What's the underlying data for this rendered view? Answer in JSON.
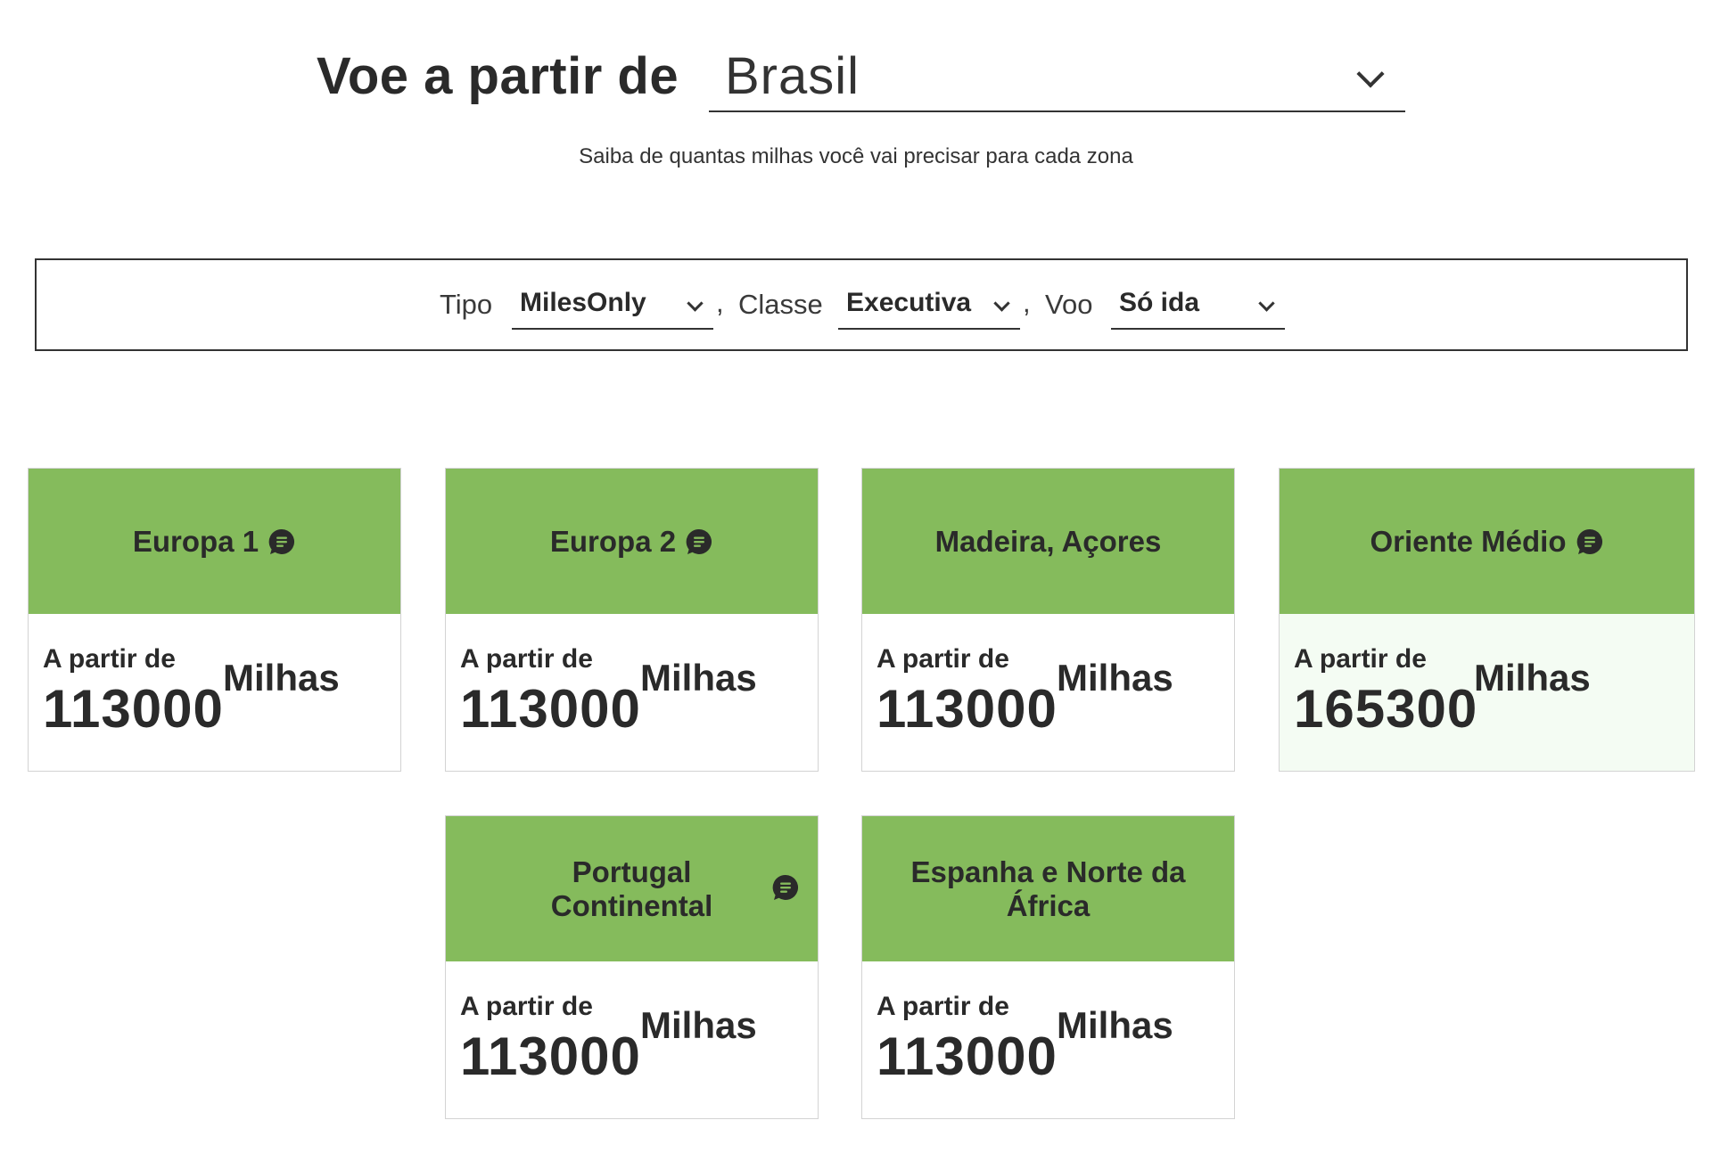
{
  "header": {
    "title": "Voe a partir de",
    "country_select": {
      "value": "Brasil"
    },
    "subtitle": "Saiba de quantas milhas você vai precisar para cada zona"
  },
  "filters": {
    "tipo": {
      "label": "Tipo",
      "value": "MilesOnly"
    },
    "classe": {
      "label": "Classe",
      "value": "Executiva"
    },
    "voo": {
      "label": "Voo",
      "value": "Só ida"
    },
    "separator": ","
  },
  "cards": [
    {
      "title": "Europa 1",
      "has_chat_icon": true,
      "from_label": "A partir de",
      "value": "113000",
      "unit": "Milhas"
    },
    {
      "title": "Europa 2",
      "has_chat_icon": true,
      "from_label": "A partir de",
      "value": "113000",
      "unit": "Milhas"
    },
    {
      "title": "Madeira, Açores",
      "has_chat_icon": false,
      "from_label": "A partir de",
      "value": "113000",
      "unit": "Milhas"
    },
    {
      "title": "Oriente Médio",
      "has_chat_icon": true,
      "from_label": "A partir de",
      "value": "165300",
      "unit": "Milhas"
    },
    {
      "title": "Portugal Continental",
      "has_chat_icon": true,
      "from_label": "A partir de",
      "value": "113000",
      "unit": "Milhas"
    },
    {
      "title": "Espanha e Norte da África",
      "has_chat_icon": false,
      "from_label": "A partir de",
      "value": "113000",
      "unit": "Milhas"
    }
  ],
  "colors": {
    "card_header": "#85bb5c",
    "card_highlight_body": "#f4fcf3",
    "text": "#2a2a2a"
  },
  "icons": {
    "chat": "chat-bubble-icon",
    "dropdown": "chevron-down-icon"
  }
}
